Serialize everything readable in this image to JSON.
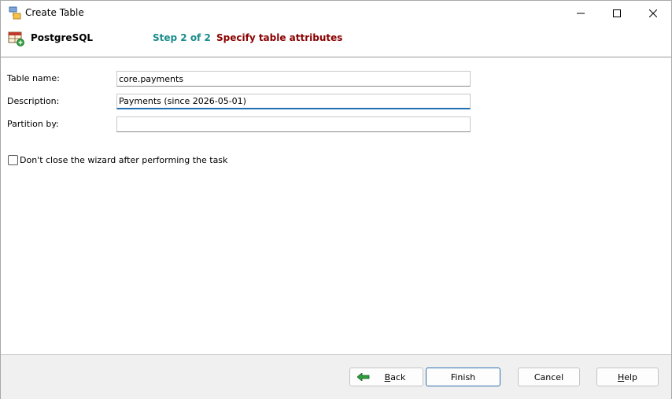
{
  "window": {
    "title": "Create Table",
    "minimize_icon": "minimize-icon",
    "maximize_icon": "maximize-icon",
    "close_icon": "close-icon"
  },
  "header": {
    "db_name": "PostgreSQL",
    "step_label": "Step 2 of 2",
    "step_title": "Specify table attributes"
  },
  "form": {
    "table_name": {
      "label": "Table name:",
      "value": "core.payments"
    },
    "description": {
      "label": "Description:",
      "value": "Payments (since 2026-05-01)"
    },
    "partition_by": {
      "label": "Partition by:",
      "value": ""
    }
  },
  "options": {
    "keep_open_label": "Don't close the wizard after performing the task",
    "keep_open_checked": false
  },
  "buttons": {
    "back": "Back",
    "finish": "Finish",
    "cancel": "Cancel",
    "help": "Help"
  },
  "colors": {
    "step_label": "#1a8c8c",
    "step_title": "#8b0000",
    "focus_accent": "#1f6fb2",
    "footer_bg": "#f0f0f0"
  }
}
